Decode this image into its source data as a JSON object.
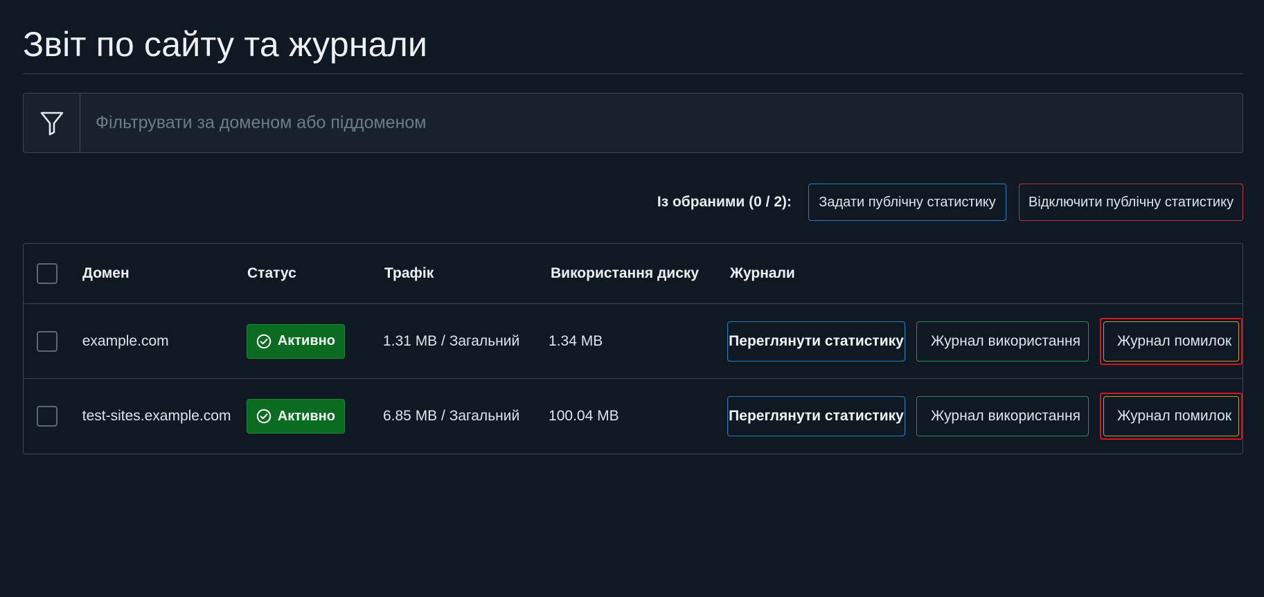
{
  "page": {
    "title": "Звіт по сайту та журнали"
  },
  "filter": {
    "placeholder": "Фільтрувати за доменом або піддоменом",
    "value": ""
  },
  "bulk": {
    "label": "Із обраними (0 / 2):",
    "set_public_label": "Задати публічну статистику",
    "disable_public_label": "Відключити публічну статистику"
  },
  "table": {
    "headers": {
      "domain": "Домен",
      "status": "Статус",
      "traffic": "Трафік",
      "disk": "Використання диску",
      "logs": "Журнали"
    },
    "rows": [
      {
        "domain": "example.com",
        "status": "Активно",
        "traffic": "1.31 MB / Загальний",
        "disk": "1.34 MB",
        "view_stats": "Переглянути статистику",
        "usage_log": "Журнал використання",
        "error_log": "Журнал помилок"
      },
      {
        "domain": "test-sites.example.com",
        "status": "Активно",
        "traffic": "6.85 MB / Загальний",
        "disk": "100.04 MB",
        "view_stats": "Переглянути статистику",
        "usage_log": "Журнал використання",
        "error_log": "Журнал помилок"
      }
    ]
  },
  "icons": {
    "filter": "filter-icon",
    "status": "check-circle-icon",
    "usage_log": "file-doc-icon",
    "error_log": "file-doc-icon"
  },
  "colors": {
    "background": "#0f1923",
    "border": "#3a4652",
    "active_badge": "#0c6b22",
    "blue_button_border": "#2b7fb8",
    "red_button_border": "#b8353d",
    "green_button_border": "#2f8f4a",
    "amber_button_border": "#c79a2e",
    "highlight": "#d9141e"
  }
}
